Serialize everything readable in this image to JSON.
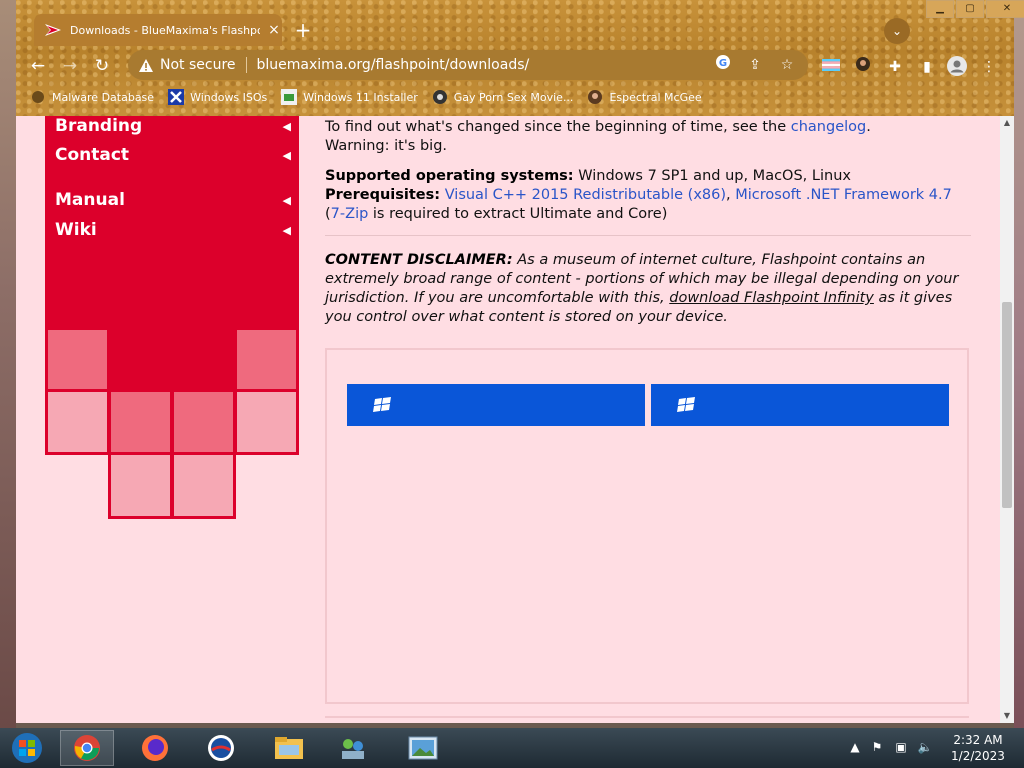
{
  "browser": {
    "tab_title": "Downloads - BlueMaxima's Flashpoint",
    "tab_close": "×",
    "new_tab": "+",
    "tab_search": "⌄",
    "window_buttons": {
      "minimize": "▁",
      "maximize": "▢",
      "close": "✕"
    },
    "security_label": "Not secure",
    "url": "bluemaxima.org/flashpoint/downloads/",
    "bookmarks": [
      {
        "label": "Malware Database",
        "icon": "malware-icon"
      },
      {
        "label": "Windows ISOs",
        "icon": "x-icon"
      },
      {
        "label": "Windows 11 Installer",
        "icon": "installer-icon"
      },
      {
        "label": "Gay Porn Sex Movie...",
        "icon": "film-icon"
      },
      {
        "label": "Espectral McGee",
        "icon": "avatar-icon"
      }
    ]
  },
  "sidebar": {
    "items": [
      {
        "label": "Branding",
        "arrow": "◀"
      },
      {
        "label": "Contact",
        "arrow": "◀"
      },
      {
        "label": "Manual",
        "arrow": "◀"
      },
      {
        "label": "Wiki",
        "arrow": "◀"
      }
    ]
  },
  "content": {
    "changelog_prefix": "To find out what's changed since the beginning of time, see the ",
    "changelog_link": "changelog",
    "changelog_suffix": ".",
    "warning": "Warning: it's big.",
    "supported_label": "Supported operating systems:",
    "supported_value": " Windows 7 SP1 and up, MacOS, Linux",
    "prereq_label": "Prerequisites:",
    "prereq_link1": "Visual C++ 2015 Redistributable (x86)",
    "prereq_comma": ", ",
    "prereq_link2": "Microsoft .NET Framework 4.7",
    "prereq_paren_open": " (",
    "prereq_link3": "7-Zip",
    "prereq_tail": " is required to extract Ultimate and Core)",
    "disclaimer_label": "CONTENT DISCLAIMER:",
    "disclaimer_text": " As a museum of internet culture, Flashpoint contains an extremely broad range of content - portions of which may be illegal depending on your jurisdiction. If you are uncomfortable with this, ",
    "disclaimer_link": "download Flashpoint Infinity",
    "disclaimer_tail": " as it gives you control over what content is stored on your device.",
    "download_buttons": [
      {
        "label": ""
      },
      {
        "label": ""
      }
    ]
  },
  "taskbar": {
    "clock_time": "2:32 AM",
    "clock_date": "1/2/2023",
    "tray_chevron": "▲",
    "tray_flag": "⚑",
    "tray_network": "▣",
    "tray_volume": "🔈"
  },
  "colors": {
    "site_red": "#dc002b",
    "page_bg": "#ffdde3",
    "link_blue": "#2a55c8",
    "download_blue": "#0a56d8"
  }
}
